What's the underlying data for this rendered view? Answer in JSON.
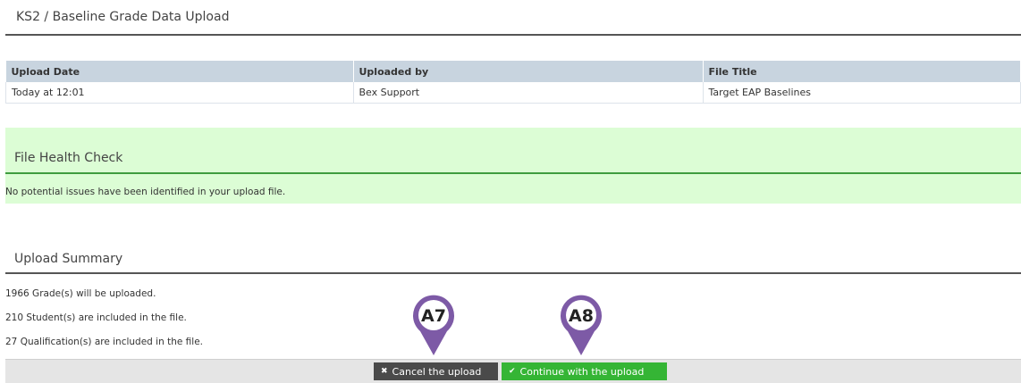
{
  "page_title": "KS2 / Baseline Grade Data Upload",
  "upload_table": {
    "headers": [
      "Upload Date",
      "Uploaded by",
      "File Title"
    ],
    "row": [
      "Today at 12:01",
      "Bex Support",
      "Target EAP Baselines"
    ]
  },
  "health_check": {
    "title": "File Health Check",
    "message": "No potential issues have been identified in your upload file."
  },
  "summary": {
    "title": "Upload Summary",
    "lines": [
      "1966 Grade(s) will be uploaded.",
      "210 Student(s) are included in the file.",
      "27 Qualification(s) are included in the file."
    ]
  },
  "actions": {
    "cancel_label": "Cancel the upload",
    "continue_label": "Continue with the upload"
  },
  "markers": [
    "A7",
    "A8"
  ],
  "colors": {
    "header_bg": "#c8d4df",
    "health_bg": "#dcfdd5",
    "cancel_bg": "#4a4a4a",
    "continue_bg": "#35b535",
    "marker": "#7d5aa6"
  }
}
